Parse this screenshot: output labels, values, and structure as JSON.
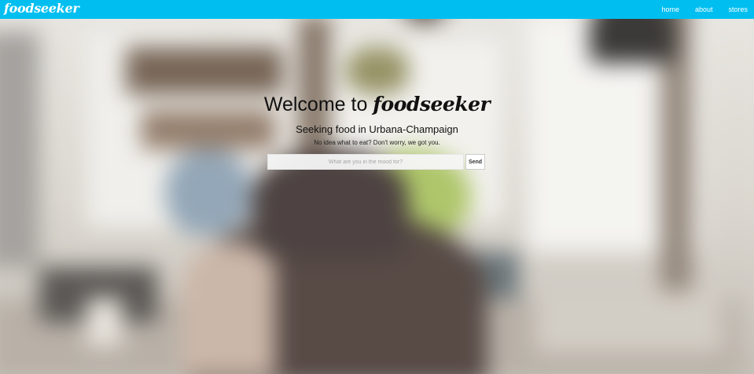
{
  "navbar": {
    "brand": "foodseeker",
    "links": [
      "home",
      "about",
      "stores"
    ]
  },
  "hero": {
    "title_prefix": "Welcome to",
    "title_brand": "foodseeker",
    "subtitle": "Seeking food in Urbana-Champaign",
    "tagline": "No idea what to eat? Don't worry, we got you."
  },
  "search": {
    "placeholder": "What are you in the mood for?",
    "value": "",
    "send_label": "Send"
  },
  "colors": {
    "navbar_bg": "#00bff0",
    "nav_text": "#ffffff",
    "hero_text": "#111111"
  }
}
